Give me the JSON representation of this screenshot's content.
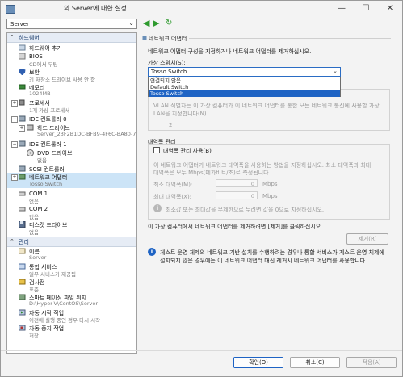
{
  "window": {
    "title": "의 Server에 대한 설정",
    "minimize": "—",
    "maximize": "☐",
    "close": "✕"
  },
  "server_select": {
    "value": "Server"
  },
  "tree": {
    "hardware_header": "하드웨어",
    "management_header": "관리",
    "items": [
      {
        "name": "하드웨어 추가",
        "sub": ""
      },
      {
        "name": "BIOS",
        "sub": "CD에서 부팅"
      },
      {
        "name": "보안",
        "sub": "키 저장소 드라이브 사용 안 함"
      },
      {
        "name": "메모리",
        "sub": "1024MB"
      },
      {
        "name": "프로세서",
        "sub": "1개 가상 프로세서"
      },
      {
        "name": "IDE 컨트롤러 0",
        "sub": ""
      },
      {
        "name": "하드 드라이브",
        "sub": "Server_23F2B1DC-BFB9-4F6C-BA80-7..."
      },
      {
        "name": "IDE 컨트롤러 1",
        "sub": ""
      },
      {
        "name": "DVD 드라이브",
        "sub": "없음"
      },
      {
        "name": "SCSI 컨트롤러",
        "sub": ""
      },
      {
        "name": "네트워크 어댑터",
        "sub": "Tosso Switch"
      },
      {
        "name": "COM 1",
        "sub": "없음"
      },
      {
        "name": "COM 2",
        "sub": "없음"
      },
      {
        "name": "디스켓 드라이브",
        "sub": "없음"
      }
    ],
    "mgmt_items": [
      {
        "name": "이름",
        "sub": "Server"
      },
      {
        "name": "통합 서비스",
        "sub": "일부 서비스가 제공됨"
      },
      {
        "name": "검사점",
        "sub": "표준"
      },
      {
        "name": "스마트 페이징 파일 위치",
        "sub": "D:\\Hyper-V\\CentOS\\Server"
      },
      {
        "name": "자동 시작 작업",
        "sub": "이전에 실행 중인 경우 다시 시작"
      },
      {
        "name": "자동 중지 작업",
        "sub": "저장"
      }
    ]
  },
  "panel": {
    "title": "네트워크 어댑터",
    "desc": "네트워크 어댑터 구성을 지정하거나 네트워크 어댑터를 제거하십시오.",
    "switch_label": "가상 스위치(S):",
    "switch_value": "Tosso Switch",
    "switch_options": [
      "연결되지 않음",
      "Default Switch",
      "Tosso Switch"
    ],
    "vlan_text1": "VLAN 식별자는 이 가상 컴퓨터가 이 네트워크 어댑터를 통한 모든 네트워크 통신에 사용할 가상",
    "vlan_text2": "LAN을 지정합니다(N).",
    "vlan_value": "2",
    "bandwidth_title": "대역폭 관리",
    "bandwidth_check": "대역폭 관리 사용(B)",
    "bw_desc1": "이 네트워크 어댑터가 네트워크 대역폭을 사용하는 방법을 지정하십시오. 최소 대역폭과 최대",
    "bw_desc2": "대역폭은 모두 Mbps(메가비트/초)로 측정됩니다.",
    "min_label": "최소 대역폭(M):",
    "min_value": "0",
    "max_label": "최대 대역폭(X):",
    "max_value": "0",
    "unit": "Mbps",
    "zero_note": "최소값 또는 최대값을 무제한으로 두려면 값을 0으로 지정하십시오.",
    "remove_text": "이 가상 컴퓨터에서 네트워크 어댑터를 제거하려면 [제거]를 클릭하십시오.",
    "remove_button": "제거(R)",
    "legacy_text1": "게스트 운영 체제의 네트워크 기반 설치를 수행하려는 경우나 통합 서비스가 게스트 운영 체제에",
    "legacy_text2": "설치되지 않은 경우에는 이 네트워크 어댑터 대신 레거시 네트워크 어댑터를 사용합니다."
  },
  "buttons": {
    "ok": "확인(O)",
    "cancel": "취소(C)",
    "apply": "적용(A)"
  }
}
